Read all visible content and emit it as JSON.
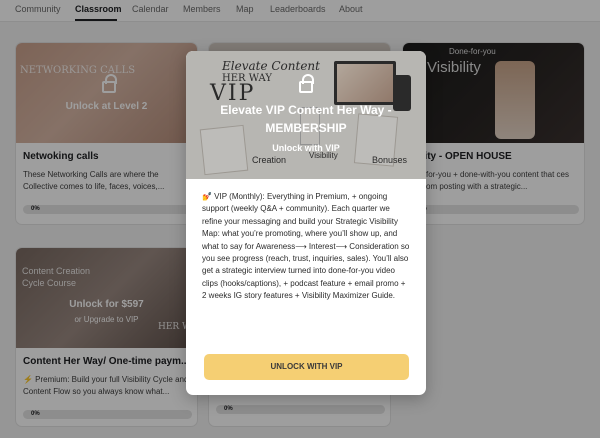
{
  "nav": {
    "tabs": [
      {
        "label": "Community"
      },
      {
        "label": "Classroom",
        "active": true
      },
      {
        "label": "Calendar"
      },
      {
        "label": "Members"
      },
      {
        "label": "Map"
      },
      {
        "label": "Leaderboards"
      },
      {
        "label": "About"
      }
    ]
  },
  "cards": [
    {
      "cover_text": "NETWORKING CALLS",
      "lock_label": "Unlock at Level 2",
      "title": "Netwoking calls",
      "description": "These Networking Calls are where the Collective comes to life, faces, voices,...",
      "progress": "0%"
    },
    {
      "cover_text": "Done-for-you",
      "cover_text_2": "Visibility",
      "title": "ibility - OPEN HOUSE",
      "description": "one-for-you + done-with-you content that ces random posting with a strategic...",
      "progress": "0%"
    },
    {
      "cover_text": "Cycle Course",
      "cover_text_2": "Content Creation",
      "lock_label": "Unlock for $597",
      "lock_sub": "or Upgrade to VIP",
      "cover_side": "HER WA",
      "title": "Content Her Way/ One-time paym...",
      "description": "⚡ Premium: Build your full Visibility Cycle and Content Flow so you always know what...",
      "progress": "0%"
    },
    {
      "progress": "0%"
    }
  ],
  "modal": {
    "hero_words": {
      "elevate": "Elevate Content",
      "her_way": "HER WAY",
      "vip": "VIP",
      "creation": "Creation",
      "visibility": "Visibility",
      "bonuses": "Bonuses"
    },
    "title": "Elevate VIP Content Her Way - MEMBERSHIP",
    "subtitle": "Unlock with VIP",
    "body": "💅 VIP (Monthly): Everything in Premium, + ongoing support (weekly Q&A + community). Each quarter we refine your messaging and build your Strategic Visibility Map: what you’re promoting, where you’ll show up, and what to say for Awareness⟶ Interest⟶ Consideration so you see progress (reach, trust, inquiries, sales). You’ll also get a strategic interview turned into done-for-you video clips (hooks/captions), + podcast feature + email promo + 2 weeks IG story features + Visibility Maximizer Guide.",
    "button": "UNLOCK WITH VIP"
  },
  "colors": {
    "accent_button": "#f5cf73",
    "overlay": "rgba(0,0,0,0.38)"
  }
}
